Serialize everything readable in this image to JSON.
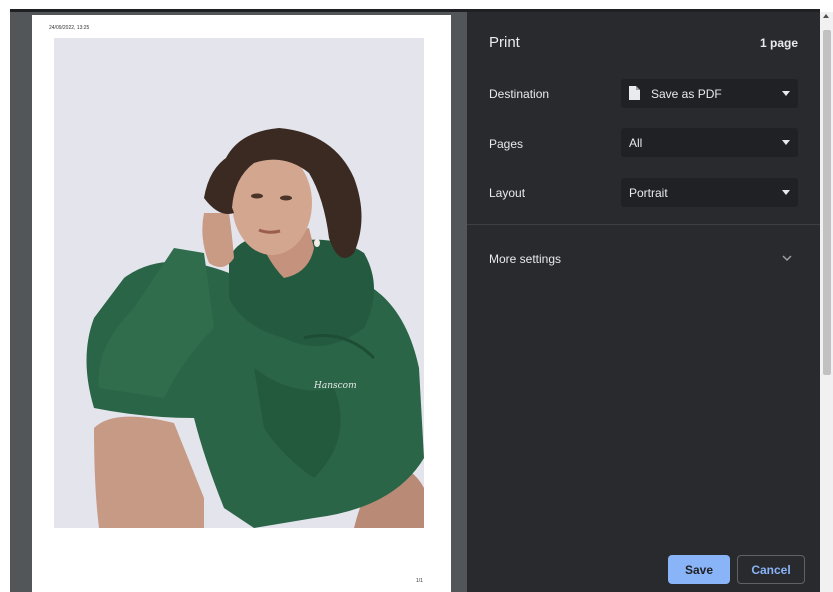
{
  "preview": {
    "header_timestamp": "24/09/2022, 13:25",
    "page_number": "1/1"
  },
  "print_panel": {
    "title": "Print",
    "page_count": "1 page",
    "destination": {
      "label": "Destination",
      "value": "Save as PDF",
      "icon": "file-icon"
    },
    "pages": {
      "label": "Pages",
      "value": "All"
    },
    "layout": {
      "label": "Layout",
      "value": "Portrait"
    },
    "more_settings": {
      "label": "More settings",
      "icon": "chevron-down-icon"
    },
    "save_label": "Save",
    "cancel_label": "Cancel"
  },
  "colors": {
    "panel_bg": "#292a2d",
    "select_bg": "#202124",
    "accent": "#8ab4f8",
    "preview_bg": "#525659",
    "hoodie_green": "#2a6547"
  }
}
